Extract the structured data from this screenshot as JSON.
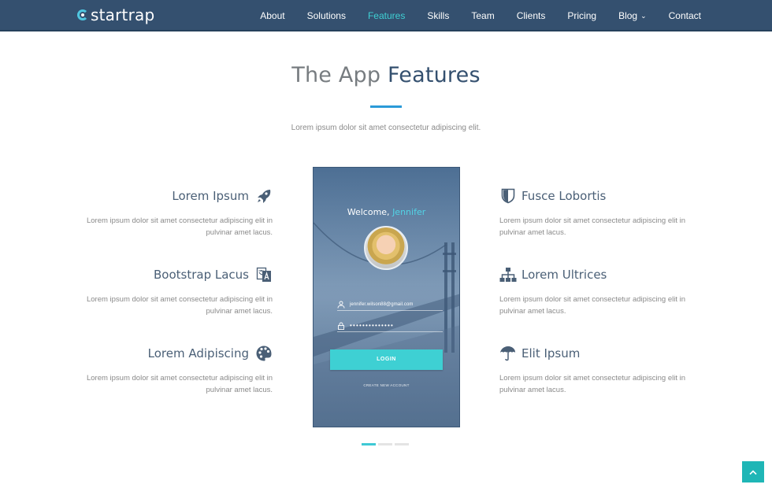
{
  "brand": {
    "name": "startrap"
  },
  "nav": {
    "items": [
      {
        "label": "About"
      },
      {
        "label": "Solutions"
      },
      {
        "label": "Features",
        "active": true
      },
      {
        "label": "Skills"
      },
      {
        "label": "Team"
      },
      {
        "label": "Clients"
      },
      {
        "label": "Pricing"
      },
      {
        "label": "Blog",
        "dropdown": true
      },
      {
        "label": "Contact"
      }
    ]
  },
  "section": {
    "title_light": "The App",
    "title_strong": "Features",
    "subtitle": "Lorem ipsum dolor sit amet consectetur adipiscing elit."
  },
  "features_left": [
    {
      "title": "Lorem Ipsum",
      "icon": "rocket-icon",
      "text": "Lorem ipsum dolor sit amet consectetur adipiscing elit in pulvinar amet lacus."
    },
    {
      "title": "Bootstrap Lacus",
      "icon": "translate-icon",
      "text": "Lorem ipsum dolor sit amet consectetur adipiscing elit in pulvinar amet lacus."
    },
    {
      "title": "Lorem Adipiscing",
      "icon": "palette-icon",
      "text": "Lorem ipsum dolor sit amet consectetur adipiscing elit in pulvinar amet lacus."
    }
  ],
  "features_right": [
    {
      "title": "Fusce Lobortis",
      "icon": "shield-icon",
      "text": "Lorem ipsum dolor sit amet consectetur adipiscing elit in pulvinar amet lacus."
    },
    {
      "title": "Lorem Ultrices",
      "icon": "sitemap-icon",
      "text": "Lorem ipsum dolor sit amet consectetur adipiscing elit in pulvinar amet lacus."
    },
    {
      "title": "Elit Ipsum",
      "icon": "umbrella-icon",
      "text": "Lorem ipsum dolor sit amet consectetur adipiscing elit in pulvinar amet lacus."
    }
  ],
  "phone": {
    "welcome": "Welcome,",
    "user_name": "Jennifer",
    "email_value": "jennifer.wilson88@gmail.com",
    "password_value": "••••••••••••••",
    "login_label": "LOGIN",
    "create_account_label": "CREATE NEW ACCOUNT"
  },
  "carousel": {
    "pages": 3,
    "active_index": 0
  },
  "colors": {
    "nav_bg": "#34506f",
    "accent": "#3fd0d4",
    "rule": "#2a9ad8",
    "heading": "#34506f"
  }
}
